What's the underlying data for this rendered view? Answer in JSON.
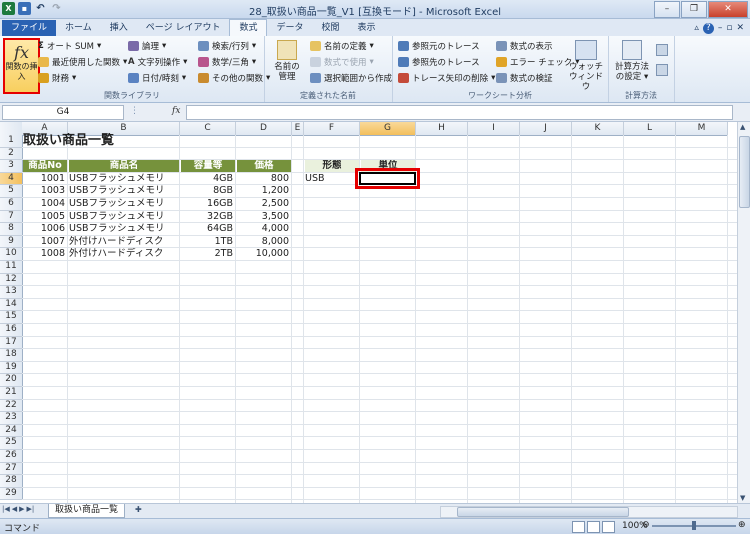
{
  "window": {
    "title": "28_取扱い商品一覧_V1 [互換モード] - Microsoft Excel"
  },
  "tabs": [
    {
      "label": "ファイル"
    },
    {
      "label": "ホーム"
    },
    {
      "label": "挿入"
    },
    {
      "label": "ページ レイアウト"
    },
    {
      "label": "数式"
    },
    {
      "label": "データ"
    },
    {
      "label": "校閲"
    },
    {
      "label": "表示"
    }
  ],
  "ribbon": {
    "insert_function": "関数の挿入",
    "library": {
      "autosum": "オート SUM",
      "recent": "最近使用した関数",
      "financial": "財務",
      "logical": "論理",
      "text": "文字列操作",
      "datetime": "日付/時刻",
      "lookup": "検索/行列",
      "math": "数学/三角",
      "other": "その他の関数",
      "label": "関数ライブラリ"
    },
    "names": {
      "manager": "名前の管理",
      "define": "名前の定義",
      "use": "数式で使用",
      "create": "選択範囲から作成",
      "label": "定義された名前"
    },
    "audit": {
      "precedents": "参照元のトレース",
      "dependents": "参照先のトレース",
      "remove": "トレース矢印の削除",
      "show": "数式の表示",
      "error": "エラー チェック",
      "evaluate": "数式の検証",
      "watch": "ウォッチ ウィンドウ",
      "label": "ワークシート分析"
    },
    "calc": {
      "options": "計算方法の設定",
      "label": "計算方法"
    }
  },
  "formula_bar": {
    "name_box": "G4",
    "fx": "fx",
    "formula": ""
  },
  "columns": [
    "A",
    "B",
    "C",
    "D",
    "E",
    "F",
    "G",
    "H",
    "I",
    "J",
    "K",
    "L",
    "M"
  ],
  "rows": [
    "1",
    "2",
    "3",
    "4",
    "5",
    "6",
    "7",
    "8",
    "9",
    "10",
    "11",
    "12",
    "13",
    "14",
    "15",
    "16",
    "17",
    "18",
    "19",
    "20",
    "21",
    "22",
    "23",
    "24",
    "25",
    "26",
    "27",
    "28",
    "29"
  ],
  "sheet": {
    "title": "取扱い商品一覧",
    "headers": [
      "商品No",
      "商品名",
      "容量等",
      "価格"
    ],
    "data": [
      [
        "1001",
        "USBフラッシュメモリ",
        "4GB",
        "800"
      ],
      [
        "1003",
        "USBフラッシュメモリ",
        "8GB",
        "1,200"
      ],
      [
        "1004",
        "USBフラッシュメモリ",
        "16GB",
        "2,500"
      ],
      [
        "1005",
        "USBフラッシュメモリ",
        "32GB",
        "3,500"
      ],
      [
        "1006",
        "USBフラッシュメモリ",
        "64GB",
        "4,000"
      ],
      [
        "1007",
        "外付けハードディスク",
        "1TB",
        "8,000"
      ],
      [
        "1008",
        "外付けハードディスク",
        "2TB",
        "10,000"
      ]
    ],
    "lookup_headers": [
      "形態",
      "単位"
    ],
    "lookup_value": "USB"
  },
  "sheet_tab": "取扱い商品一覧",
  "status": {
    "mode": "コマンド",
    "zoom": "100%"
  }
}
